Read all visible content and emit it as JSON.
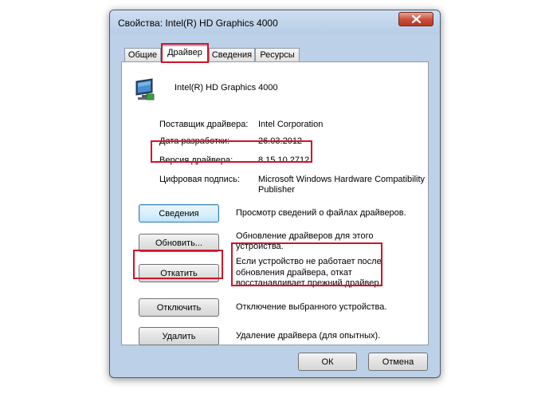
{
  "window": {
    "title": "Свойства: Intel(R) HD Graphics 4000"
  },
  "tabs": [
    {
      "label": "Общие"
    },
    {
      "label": "Драйвер"
    },
    {
      "label": "Сведения"
    },
    {
      "label": "Ресурсы"
    }
  ],
  "device": {
    "name": "Intel(R) HD Graphics 4000",
    "icon": "monitor-icon"
  },
  "properties": {
    "provider_label": "Поставщик драйвера:",
    "provider_value": "Intel Corporation",
    "date_label": "Дата разработки:",
    "date_value": "26.03.2012",
    "version_label": "Версия драйвера:",
    "version_value": "8.15.10.2712",
    "signature_label": "Цифровая подпись:",
    "signature_value_line1": "Microsoft Windows Hardware Compatibility",
    "signature_value_line2": "Publisher"
  },
  "actions": {
    "details_button": "Сведения",
    "details_desc": "Просмотр сведений о файлах драйверов.",
    "update_button": "Обновить...",
    "update_desc_line1": "Обновление драйверов для этого",
    "update_desc_line2": "устройства.",
    "rollback_button": "Откатить",
    "rollback_desc_line1": "Если устройство не работает после",
    "rollback_desc_line2": "обновления драйвера, откат",
    "rollback_desc_line3": "восстанавливает прежний драйвер.",
    "disable_button": "Отключить",
    "disable_desc": "Отключение выбранного устройства.",
    "uninstall_button": "Удалить",
    "uninstall_desc": "Удаление драйвера (для опытных)."
  },
  "footer": {
    "ok_button": "ОК",
    "cancel_button": "Отмена"
  },
  "colors": {
    "highlight": "#d2112a",
    "window_frame": "#bcd1e8"
  }
}
